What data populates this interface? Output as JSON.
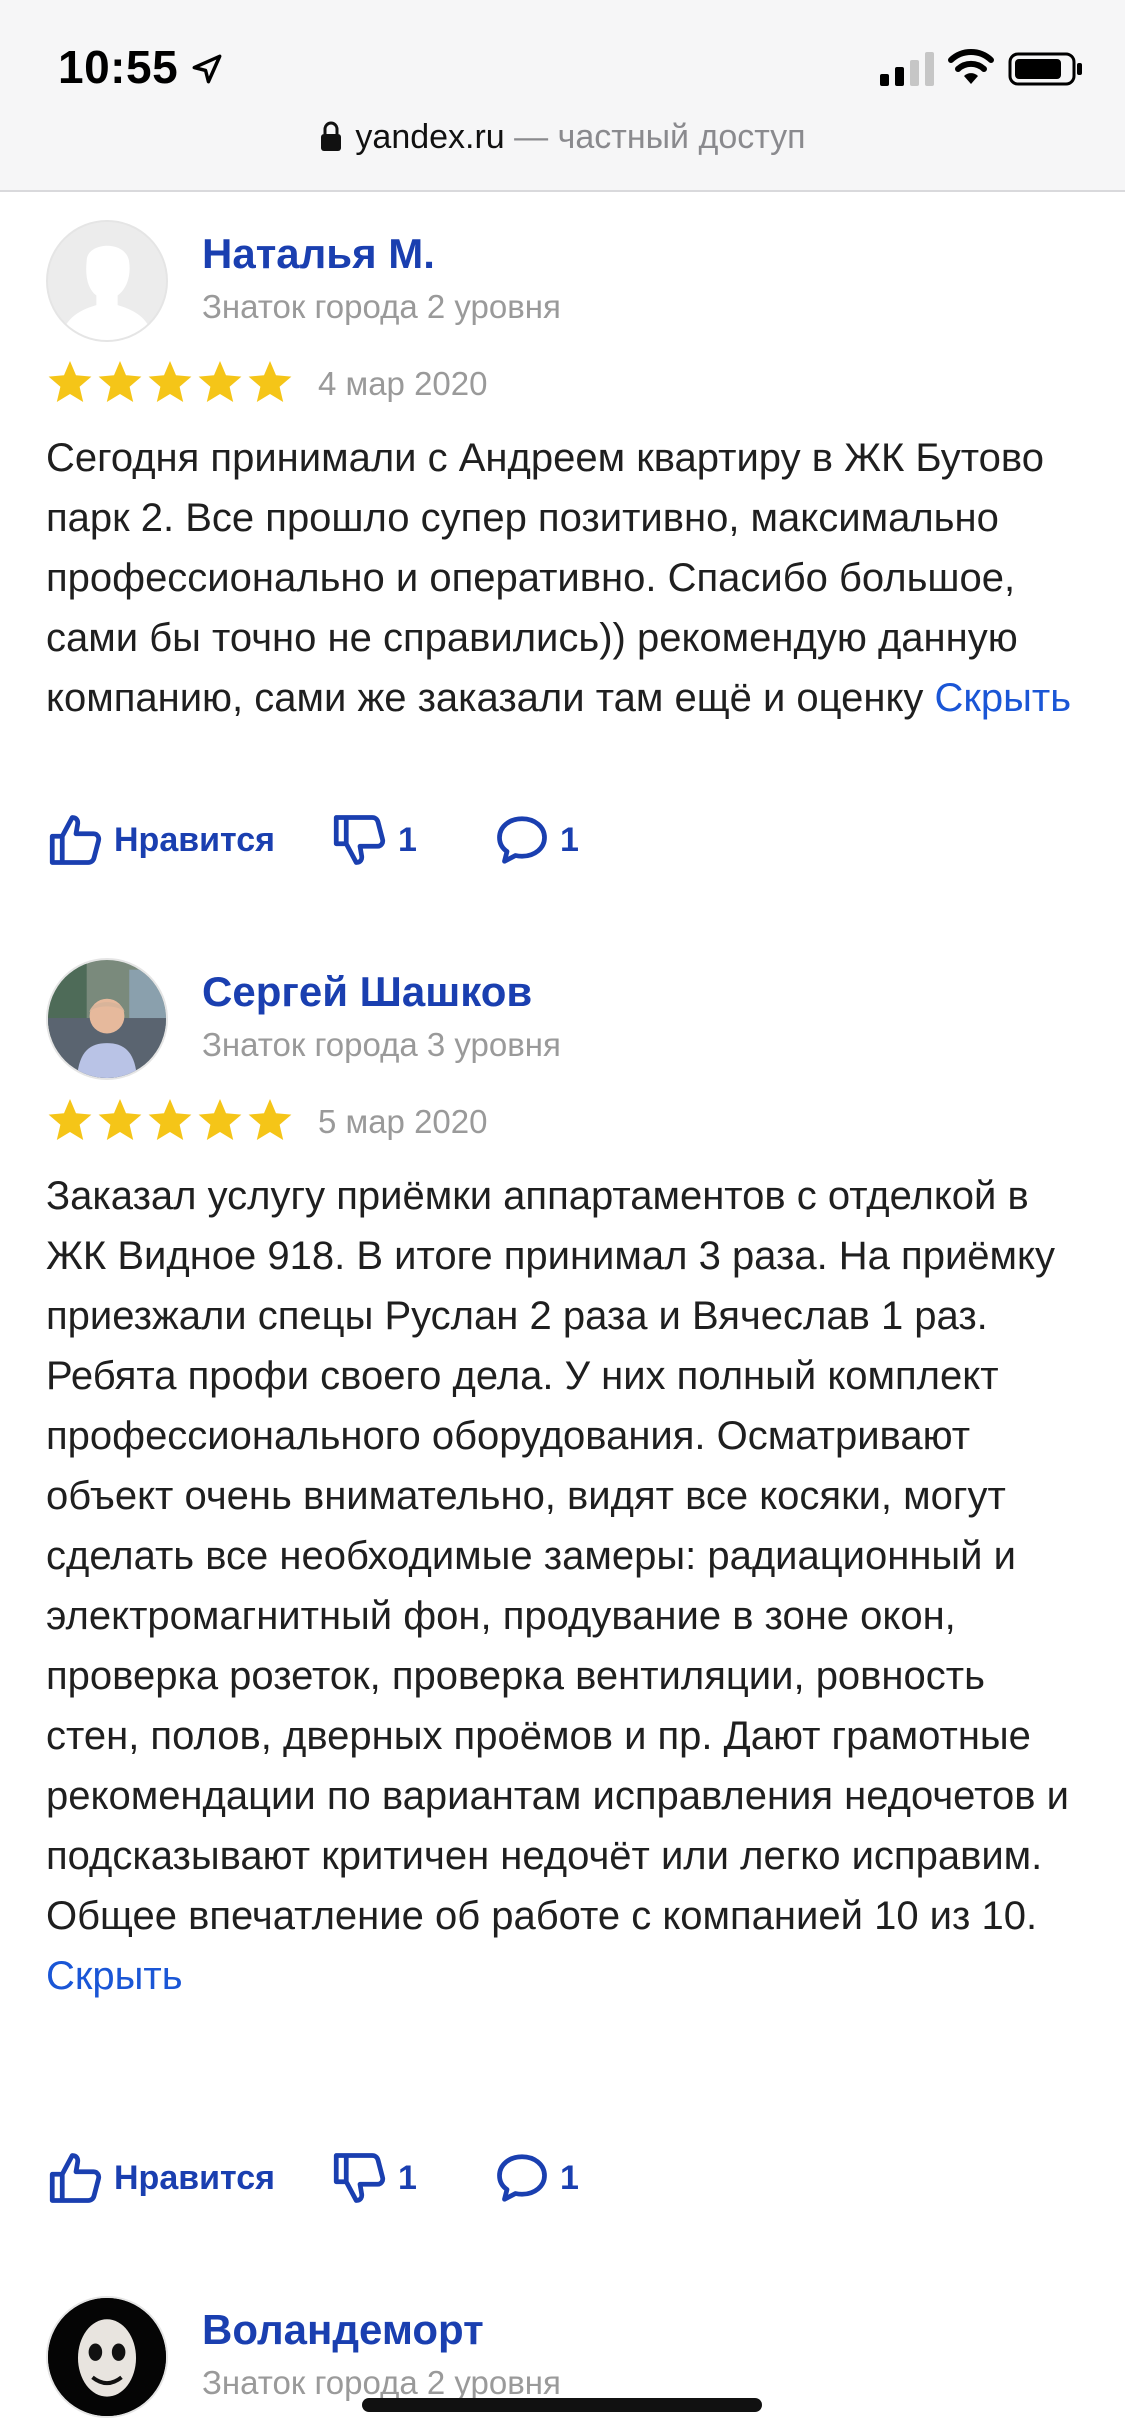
{
  "status_bar": {
    "time": "10:55",
    "url_domain": "yandex.ru",
    "url_suffix": " — частный доступ"
  },
  "reviews": [
    {
      "author": "Наталья М.",
      "level": "Знаток города 2 уровня",
      "rating": 5,
      "date": "4 мар 2020",
      "text": "Сегодня принимали с Андреем квартиру в ЖК Бутово парк 2. Все прошло супер позитивно, максимально профессионально и оперативно. Спасибо большое, сами бы точно не справились)) рекомендую данную компанию, сами же заказали там ещё и оценку",
      "hide_label": "Скрыть",
      "like_label": "Нравится",
      "dislike_count": "1",
      "comment_count": "1"
    },
    {
      "author": "Сергей Шашков",
      "level": "Знаток города 3 уровня",
      "rating": 5,
      "date": "5 мар 2020",
      "text": "Заказал услугу приёмки аппартаментов с отделкой в ЖК Видное 918. В итоге принимал 3 раза. На приёмку приезжали спецы Руслан 2 раза и Вячеслав 1 раз. Ребята профи своего дела. У них полный комплект профессионального оборудования. Осматривают объект очень внимательно, видят все косяки, могут сделать все необходимые замеры: радиационный и электромагнитный фон, продувание в зоне окон, проверка розеток, проверка вентиляции, ровность стен, полов, дверных проёмов и пр. Дают грамотные рекомендации по вариантам исправления недочетов и подсказывают критичен недочёт или легко исправим. Общее впечатление об работе с компанией 10 из 10.",
      "hide_label": "Скрыть",
      "like_label": "Нравится",
      "dislike_count": "1",
      "comment_count": "1"
    },
    {
      "author": "Воландеморт",
      "level": "Знаток города 2 уровня"
    }
  ],
  "colors": {
    "link": "#1a3fb0",
    "star": "#f5c518",
    "muted": "#9a9a9a"
  }
}
